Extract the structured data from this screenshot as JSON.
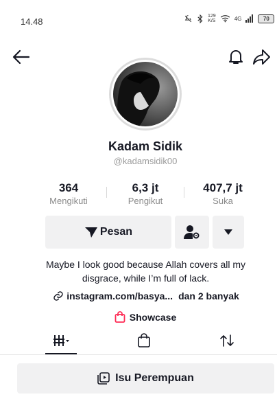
{
  "status_bar": {
    "time": "14.48",
    "network_speed": "129",
    "network_unit": "K/S",
    "network_type": "4G",
    "battery": "70"
  },
  "profile": {
    "name": "Kadam Sidik",
    "username": "@kadamsidik00"
  },
  "stats": [
    {
      "value": "364",
      "label": "Mengikuti"
    },
    {
      "value": "6,3 jt",
      "label": "Pengikut"
    },
    {
      "value": "407,7 jt",
      "label": "Suka"
    }
  ],
  "actions": {
    "message_label": "Pesan"
  },
  "bio": {
    "text": "Maybe I look good because Allah covers all my disgrace, while I’m full of lack.",
    "link_text": "instagram.com/basya...",
    "link_more": "dan 2 banyak"
  },
  "showcase": {
    "label": "Showcase"
  },
  "tabs": [
    {
      "icon": "videos-grid-icon",
      "active": true
    },
    {
      "icon": "shopping-bag-icon",
      "active": false
    },
    {
      "icon": "repost-icon",
      "active": false
    }
  ],
  "playlist": {
    "label": "Isu Perempuan"
  },
  "colors": {
    "text": "#161823",
    "muted": "#8a8a8a",
    "button_bg": "#f1f1f2",
    "showcase_accent": "#fe2c55"
  }
}
